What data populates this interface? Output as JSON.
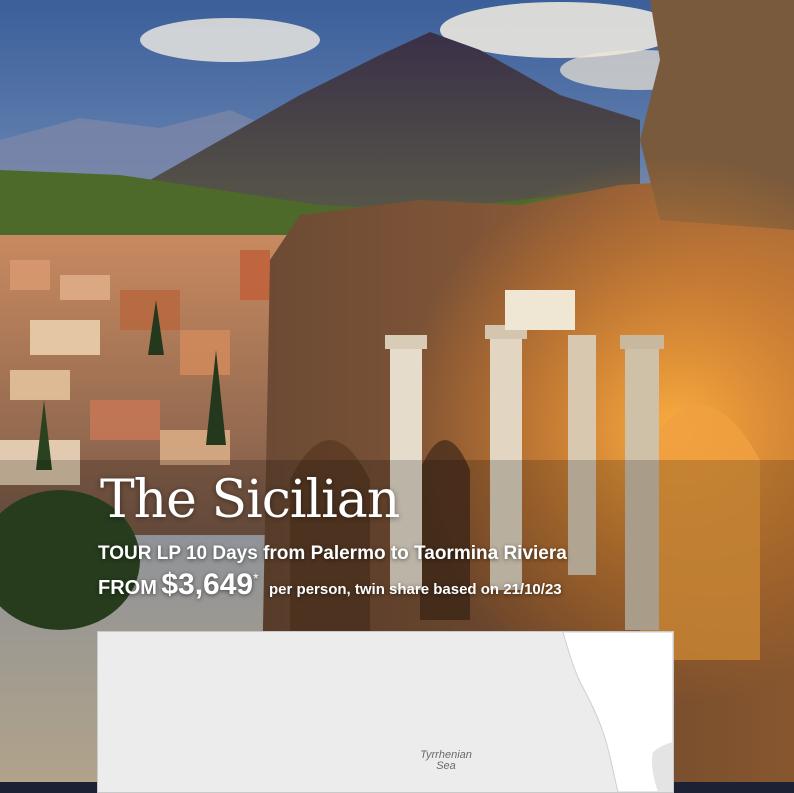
{
  "tour": {
    "title": "The Sicilian",
    "subtitle": "TOUR LP 10 Days from Palermo to Taormina Riviera",
    "price_prefix": "FROM",
    "price": "$3,649",
    "price_asterisk": "*",
    "price_note": "per person, twin share based on 21/10/23"
  },
  "map": {
    "sea_label_line1": "Tyrrhenian",
    "sea_label_line2": "Sea"
  },
  "colors": {
    "text": "#ffffff",
    "map_land": "#ffffff",
    "map_water": "#ececec"
  }
}
